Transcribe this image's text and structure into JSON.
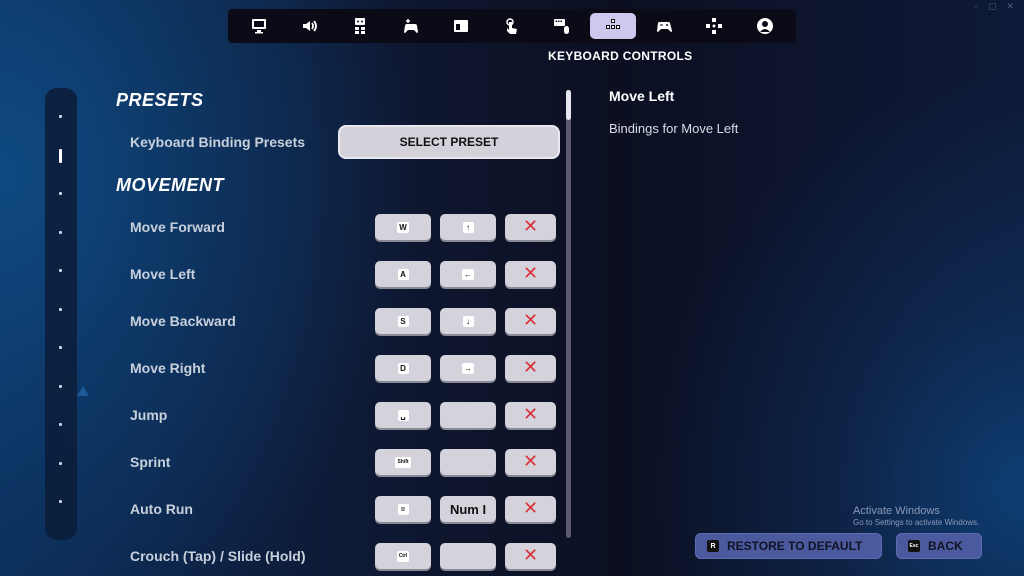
{
  "window_controls": {
    "minimize": "–",
    "maximize": "▢",
    "close": "✕"
  },
  "nav": {
    "tabs": [
      {
        "icon": "monitor-icon",
        "label": "Display",
        "active": false
      },
      {
        "icon": "speaker-icon",
        "label": "Audio",
        "active": false
      },
      {
        "icon": "accessibility-icon",
        "label": "Accessibility",
        "active": false
      },
      {
        "icon": "controller-touch-icon",
        "label": "Input",
        "active": false
      },
      {
        "icon": "window-icon",
        "label": "Game UI",
        "active": false
      },
      {
        "icon": "touch-icon",
        "label": "Touch",
        "active": false
      },
      {
        "icon": "keyboard-mouse-icon",
        "label": "Mouse & Keyboard",
        "active": false
      },
      {
        "icon": "keyboard-keys-icon",
        "label": "Keyboard Controls",
        "active": true
      },
      {
        "icon": "gamepad-icon",
        "label": "Controller",
        "active": false
      },
      {
        "icon": "dpad-icon",
        "label": "Controller Bindings",
        "active": false
      },
      {
        "icon": "account-icon",
        "label": "Account",
        "active": false
      }
    ],
    "active_caption": "KEYBOARD CONTROLS"
  },
  "side_rail": {
    "dot_count": 11,
    "active_index": 1
  },
  "sections": {
    "presets": {
      "heading": "PRESETS",
      "row_label": "Keyboard Binding Presets",
      "button_label": "SELECT PRESET"
    },
    "movement": {
      "heading": "MOVEMENT",
      "rows": [
        {
          "label": "Move Forward",
          "primary": "W",
          "secondary": "↑",
          "secondary_type": "keycap"
        },
        {
          "label": "Move Left",
          "primary": "A",
          "secondary": "←",
          "secondary_type": "keycap"
        },
        {
          "label": "Move Backward",
          "primary": "S",
          "secondary": "↓",
          "secondary_type": "keycap"
        },
        {
          "label": "Move Right",
          "primary": "D",
          "secondary": "→",
          "secondary_type": "keycap"
        },
        {
          "label": "Jump",
          "primary": "␣",
          "secondary": "",
          "secondary_type": "empty"
        },
        {
          "label": "Sprint",
          "primary": "Shift",
          "secondary": "",
          "secondary_type": "empty"
        },
        {
          "label": "Auto Run",
          "primary": "=",
          "secondary": "Num I",
          "secondary_type": "text"
        },
        {
          "label": "Crouch (Tap) / Slide (Hold)",
          "primary": "Ctrl",
          "secondary": "",
          "secondary_type": "empty"
        }
      ],
      "clear_glyph": "✕"
    }
  },
  "scrollbar": {
    "position_fraction": 0.0,
    "visible_fraction": 0.07
  },
  "detail": {
    "title": "Move Left",
    "description": "Bindings for Move Left"
  },
  "watermark": {
    "line1": "Activate Windows",
    "line2": "Go to Settings to activate Windows."
  },
  "footer": {
    "restore": {
      "key": "R",
      "label": "RESTORE TO DEFAULT"
    },
    "back": {
      "key": "Esc",
      "label": "BACK"
    }
  },
  "colors": {
    "active_tab": "#cfc8ee",
    "clear_x": "#d9313a",
    "footer_button": "#4b5a9e",
    "key_button": "#d4d3db"
  }
}
